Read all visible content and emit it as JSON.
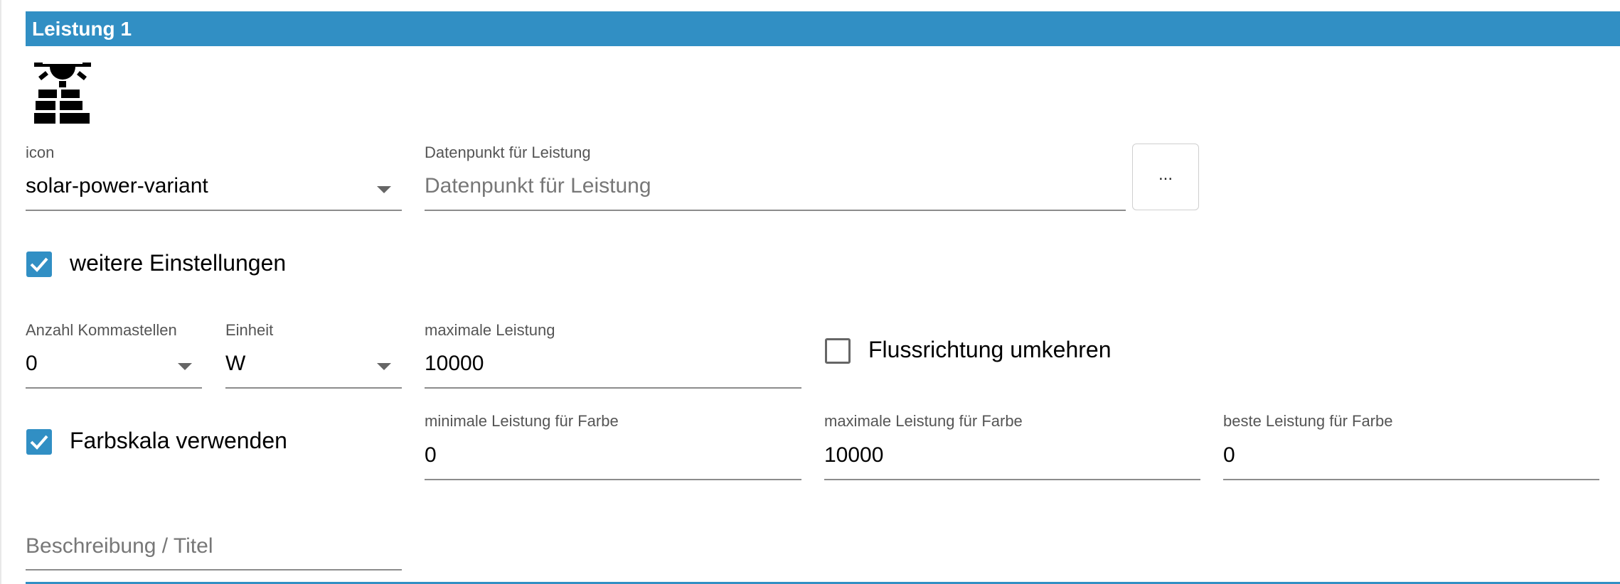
{
  "panel": {
    "title": "Leistung 1"
  },
  "icon_field": {
    "label": "icon",
    "value": "solar-power-variant",
    "icon_name": "solar-power-variant-icon"
  },
  "datapoint_field": {
    "label": "Datenpunkt für Leistung",
    "placeholder": "Datenpunkt für Leistung",
    "browse_label": "..."
  },
  "more_settings": {
    "label": "weitere Einstellungen",
    "checked": true
  },
  "decimals_field": {
    "label": "Anzahl Kommastellen",
    "value": "0"
  },
  "unit_field": {
    "label": "Einheit",
    "value": "W"
  },
  "max_power_field": {
    "label": "maximale Leistung",
    "value": "10000"
  },
  "reverse_flow": {
    "label": "Flussrichtung umkehren",
    "checked": false
  },
  "color_scale": {
    "label": "Farbskala verwenden",
    "checked": true
  },
  "min_color_field": {
    "label": "minimale Leistung für Farbe",
    "value": "0"
  },
  "max_color_field": {
    "label": "maximale Leistung für Farbe",
    "value": "10000"
  },
  "best_color_field": {
    "label": "beste Leistung für Farbe",
    "value": "0"
  },
  "description_field": {
    "placeholder": "Beschreibung / Titel"
  },
  "colors": {
    "accent": "#318fc4",
    "underline": "#8c8c8c",
    "label": "#555555"
  }
}
